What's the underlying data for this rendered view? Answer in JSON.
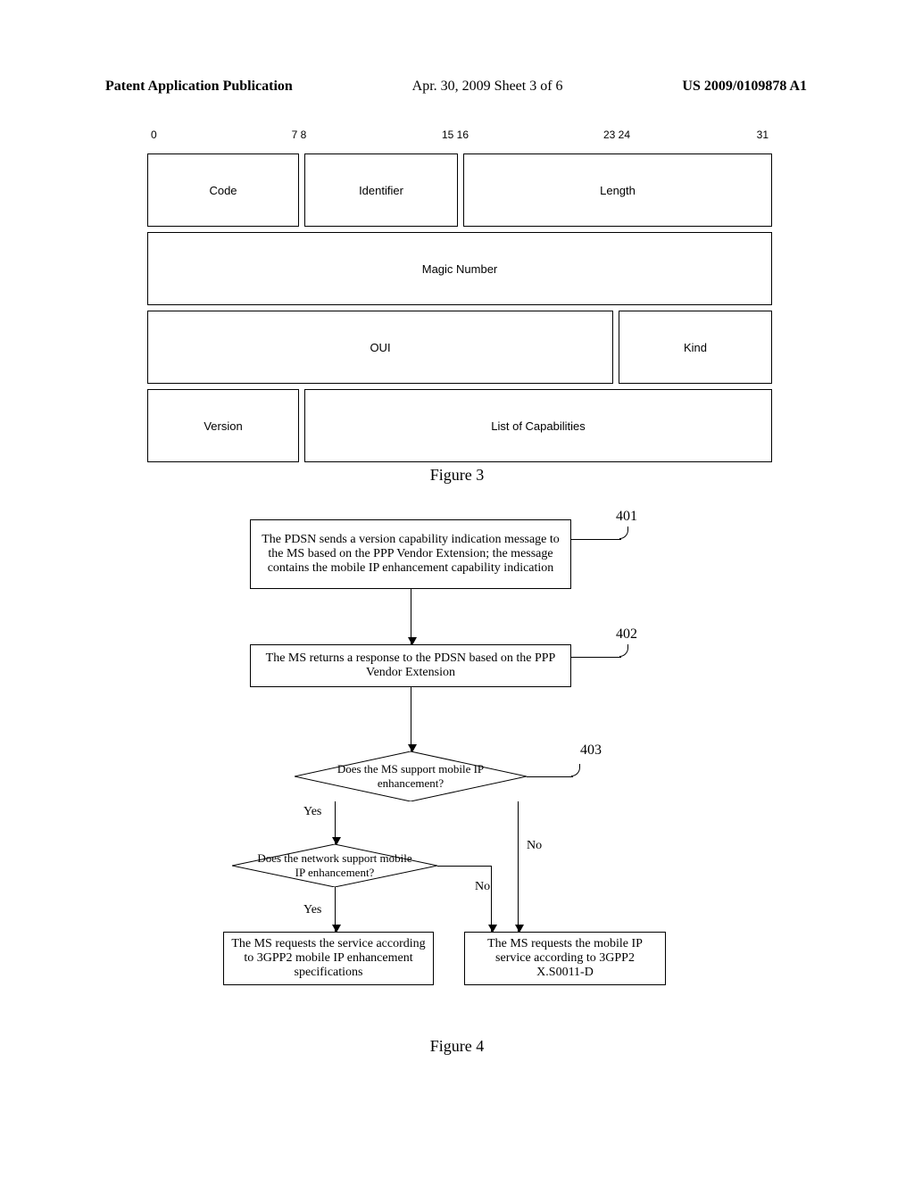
{
  "header": {
    "left": "Patent Application Publication",
    "center": "Apr. 30, 2009  Sheet 3 of 6",
    "right": "US 2009/0109878 A1"
  },
  "packet": {
    "bits": {
      "b0": "0",
      "b78": "7 8",
      "b1516": "15 16",
      "b2324": "23 24",
      "b31": "31"
    },
    "row1": {
      "code": "Code",
      "identifier": "Identifier",
      "length": "Length"
    },
    "row2": {
      "magic": "Magic Number"
    },
    "row3": {
      "oui": "OUI",
      "kind": "Kind"
    },
    "row4": {
      "version": "Version",
      "listcap": "List of  Capabilities"
    }
  },
  "captions": {
    "fig3": "Figure 3",
    "fig4": "Figure 4"
  },
  "flow": {
    "labels": {
      "l401": "401",
      "l402": "402",
      "l403": "403"
    },
    "step401": "The PDSN sends a version capability indication message to the MS based on the PPP Vendor Extension; the message contains the mobile IP enhancement capability indication",
    "step402": "The MS returns a response to the PDSN based on the PPP Vendor Extension",
    "decision403": "Does the MS support mobile IP enhancement?",
    "decisionNet": "Does the network support mobile IP enhancement?",
    "yes": "Yes",
    "no": "No",
    "resultLeft": "The MS requests the service according to 3GPP2 mobile IP enhancement specifications",
    "resultRight": "The MS requests the mobile IP service according to 3GPP2 X.S0011-D"
  },
  "chart_data": [
    {
      "type": "table",
      "title": "Figure 3 — PPP Vendor Extension packet format (bit layout 0–31)",
      "fields": [
        {
          "name": "Code",
          "bits": "0-7"
        },
        {
          "name": "Identifier",
          "bits": "8-15"
        },
        {
          "name": "Length",
          "bits": "16-31"
        },
        {
          "name": "Magic Number",
          "bits": "0-31"
        },
        {
          "name": "OUI",
          "bits": "0-23"
        },
        {
          "name": "Kind",
          "bits": "24-31"
        },
        {
          "name": "Version",
          "bits": "0-7"
        },
        {
          "name": "List of Capabilities",
          "bits": "8-31"
        }
      ]
    },
    {
      "type": "flowchart",
      "title": "Figure 4 — Mobile IP enhancement capability negotiation",
      "nodes": [
        {
          "id": "401",
          "type": "process",
          "text": "The PDSN sends a version capability indication message to the MS based on the PPP Vendor Extension; the message contains the mobile IP enhancement capability indication"
        },
        {
          "id": "402",
          "type": "process",
          "text": "The MS returns a response to the PDSN based on the PPP Vendor Extension"
        },
        {
          "id": "403",
          "type": "decision",
          "text": "Does the MS support mobile IP enhancement?"
        },
        {
          "id": "NET",
          "type": "decision",
          "text": "Does the network support mobile IP enhancement?"
        },
        {
          "id": "RL",
          "type": "process",
          "text": "The MS requests the service according to 3GPP2 mobile IP enhancement specifications"
        },
        {
          "id": "RR",
          "type": "process",
          "text": "The MS requests the mobile IP service according to 3GPP2 X.S0011-D"
        }
      ],
      "edges": [
        {
          "from": "401",
          "to": "402"
        },
        {
          "from": "402",
          "to": "403"
        },
        {
          "from": "403",
          "to": "NET",
          "label": "Yes"
        },
        {
          "from": "403",
          "to": "RR",
          "label": "No"
        },
        {
          "from": "NET",
          "to": "RL",
          "label": "Yes"
        },
        {
          "from": "NET",
          "to": "RR",
          "label": "No"
        }
      ]
    }
  ]
}
